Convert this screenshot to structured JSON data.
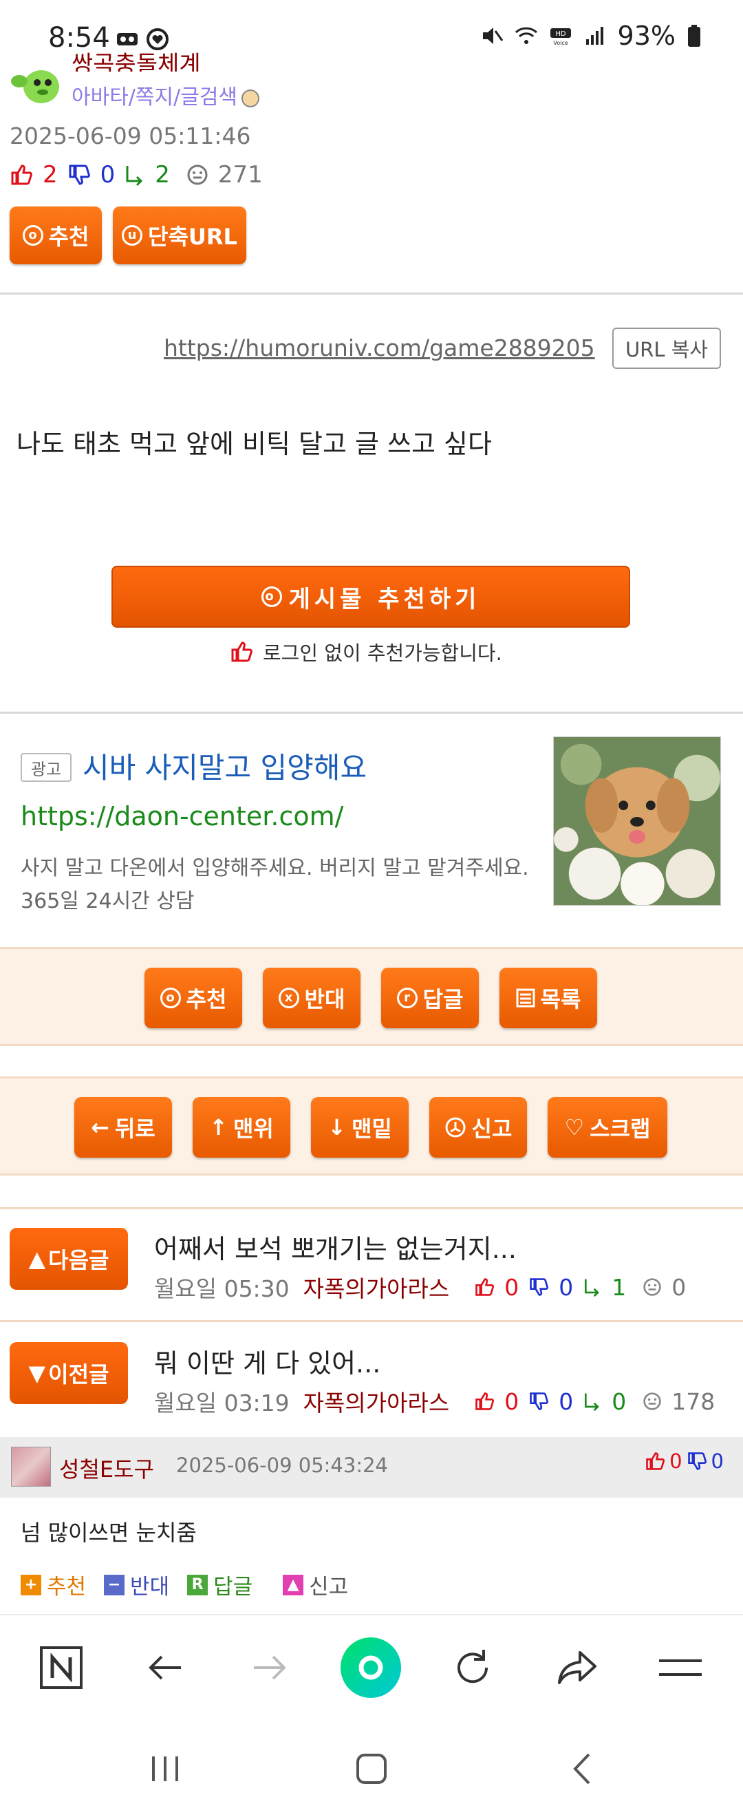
{
  "status_bar": {
    "time": "8:54",
    "battery": "93%"
  },
  "author": {
    "name": "쌍곡충돌체계",
    "links": "아바타/쪽지/글검색"
  },
  "post": {
    "date": "2025-06-09 05:11:46",
    "up": "2",
    "down": "0",
    "replies": "2",
    "views": "271",
    "short_url": "https://humoruniv.com/game2889205",
    "body": "나도 태초 먹고 앞에 비틱 달고 글 쓰고 싶다"
  },
  "buttons": {
    "recommend": "추천",
    "short_url": "단축URL",
    "copy_url": "URL 복사",
    "recommend_post": "게시물  추천하기",
    "login_note": "로그인 없이 추천가능합니다."
  },
  "ad": {
    "label": "광고",
    "title": "시바 사지말고 입양해요",
    "url": "https://daon-center.com/",
    "desc": "사지 말고 다온에서 입양해주세요. 버리지 말고 맡겨주세요. 365일 24시간 상담"
  },
  "action_row1": [
    {
      "label": "추천",
      "icon": "o"
    },
    {
      "label": "반대",
      "icon": "x"
    },
    {
      "label": "답글",
      "icon": "r"
    },
    {
      "label": "목록",
      "icon": "list"
    }
  ],
  "action_row2": [
    {
      "label": "뒤로",
      "icon": "←"
    },
    {
      "label": "맨위",
      "icon": "↑"
    },
    {
      "label": "맨밑",
      "icon": "↓"
    },
    {
      "label": "신고",
      "icon": "alert"
    },
    {
      "label": "스크랩",
      "icon": "♡"
    }
  ],
  "next_post": {
    "button": "다음글",
    "title": "어째서 보석 뽀개기는 없는거지...",
    "time": "월요일 05:30",
    "author": "자폭의가아라스",
    "up": "0",
    "down": "0",
    "replies": "1",
    "views": "0"
  },
  "prev_post": {
    "button": "이전글",
    "title": "뭐 이딴 게 다 있어...",
    "time": "월요일 03:19",
    "author": "자폭의가아라스",
    "up": "0",
    "down": "0",
    "replies": "0",
    "views": "178"
  },
  "comment": {
    "name": "성철E도구",
    "date": "2025-06-09 05:43:24",
    "up": "0",
    "down": "0",
    "body": "넘 많이쓰면 눈치줌",
    "actions": {
      "recommend": "추천",
      "oppose": "반대",
      "reply": "답글",
      "report": "신고"
    }
  },
  "colors": {
    "accent_orange": "#e85a00",
    "author_red": "#8b0000",
    "ad_title_blue": "#1a5db8",
    "ad_url_green": "#1a8a1a",
    "band_bg": "#fdf1e6"
  },
  "icons": [
    "voicemail-icon",
    "heart-status-icon",
    "mute-icon",
    "wifi-icon",
    "hd-voice-icon",
    "signal-icon",
    "battery-icon",
    "thumbs-up-icon",
    "thumbs-down-icon",
    "reply-icon",
    "views-icon",
    "n-logo-icon",
    "back-icon",
    "forward-icon",
    "home-circle-icon",
    "refresh-icon",
    "share-icon",
    "menu-icon"
  ]
}
